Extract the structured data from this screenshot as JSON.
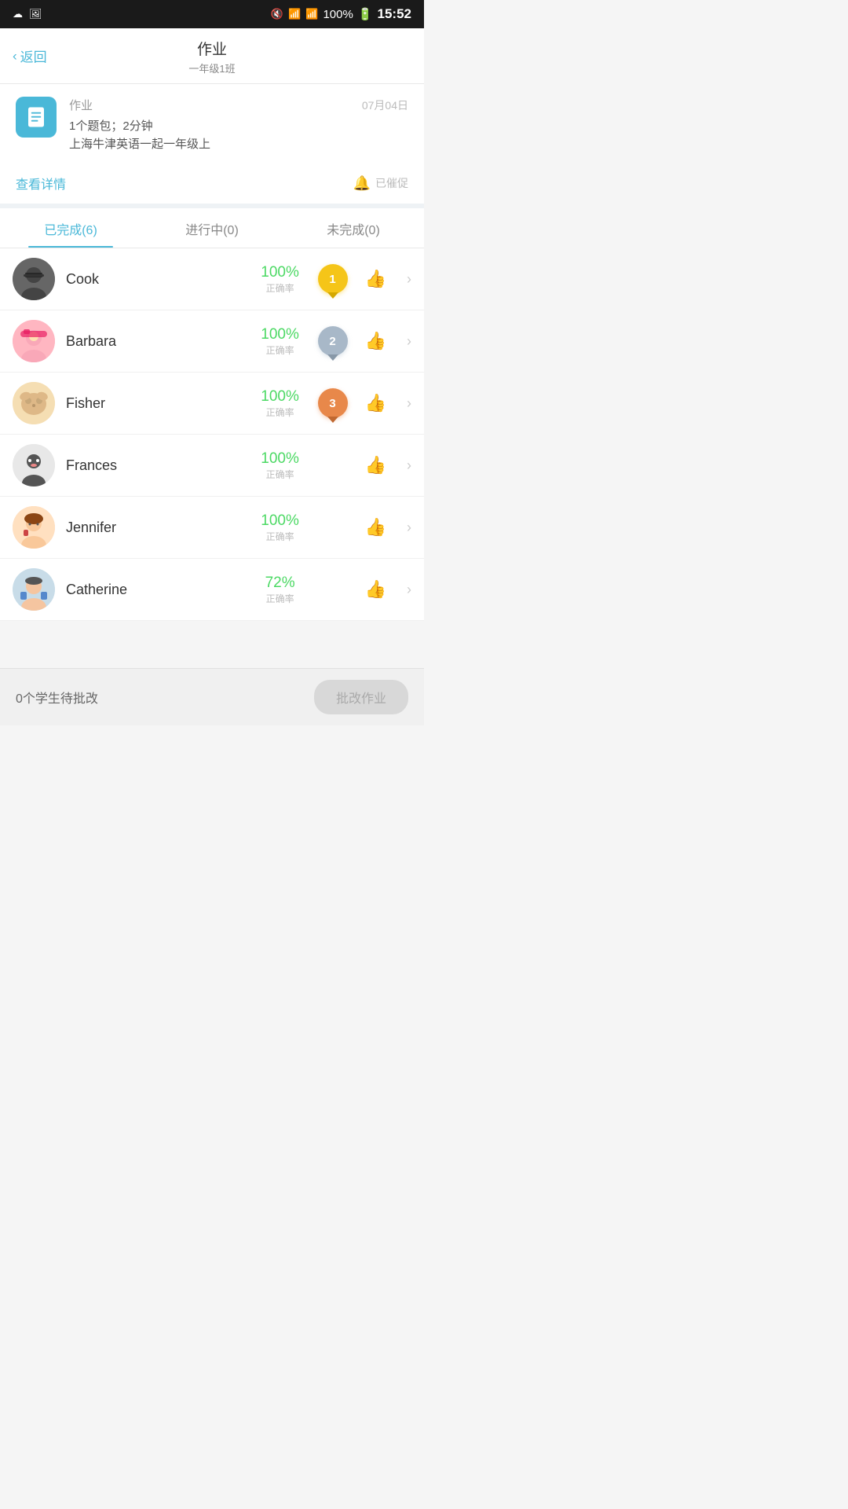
{
  "statusBar": {
    "time": "15:52",
    "battery": "100%",
    "icons": "status icons"
  },
  "nav": {
    "back": "返回",
    "title": "作业",
    "subtitle": "一年级1班"
  },
  "assignment": {
    "label": "作业",
    "date": "07月04日",
    "description1": "1个题包；2分钟",
    "description2": "上海牛津英语一起一年级上",
    "viewDetail": "查看详情",
    "reminded": "已催促"
  },
  "tabs": [
    {
      "label": "已完成(6)",
      "active": true
    },
    {
      "label": "进行中(0)",
      "active": false
    },
    {
      "label": "未完成(0)",
      "active": false
    }
  ],
  "students": [
    {
      "name": "Cook",
      "score": "100%",
      "scoreLabel": "正确率",
      "medal": 1,
      "avatar": "🧑"
    },
    {
      "name": "Barbara",
      "score": "100%",
      "scoreLabel": "正确率",
      "medal": 2,
      "avatar": "👧"
    },
    {
      "name": "Fisher",
      "score": "100%",
      "scoreLabel": "正确率",
      "medal": 3,
      "avatar": "🐶"
    },
    {
      "name": "Frances",
      "score": "100%",
      "scoreLabel": "正确率",
      "medal": 0,
      "avatar": "🧒"
    },
    {
      "name": "Jennifer",
      "score": "100%",
      "scoreLabel": "正确率",
      "medal": 0,
      "avatar": "👧"
    },
    {
      "name": "Catherine",
      "score": "72%",
      "scoreLabel": "正确率",
      "medal": 0,
      "avatar": "🧒"
    }
  ],
  "footer": {
    "pendingCount": "0个学生待批改",
    "gradeBtn": "批改作业"
  },
  "medalLabels": [
    "",
    "1",
    "2",
    "3"
  ]
}
